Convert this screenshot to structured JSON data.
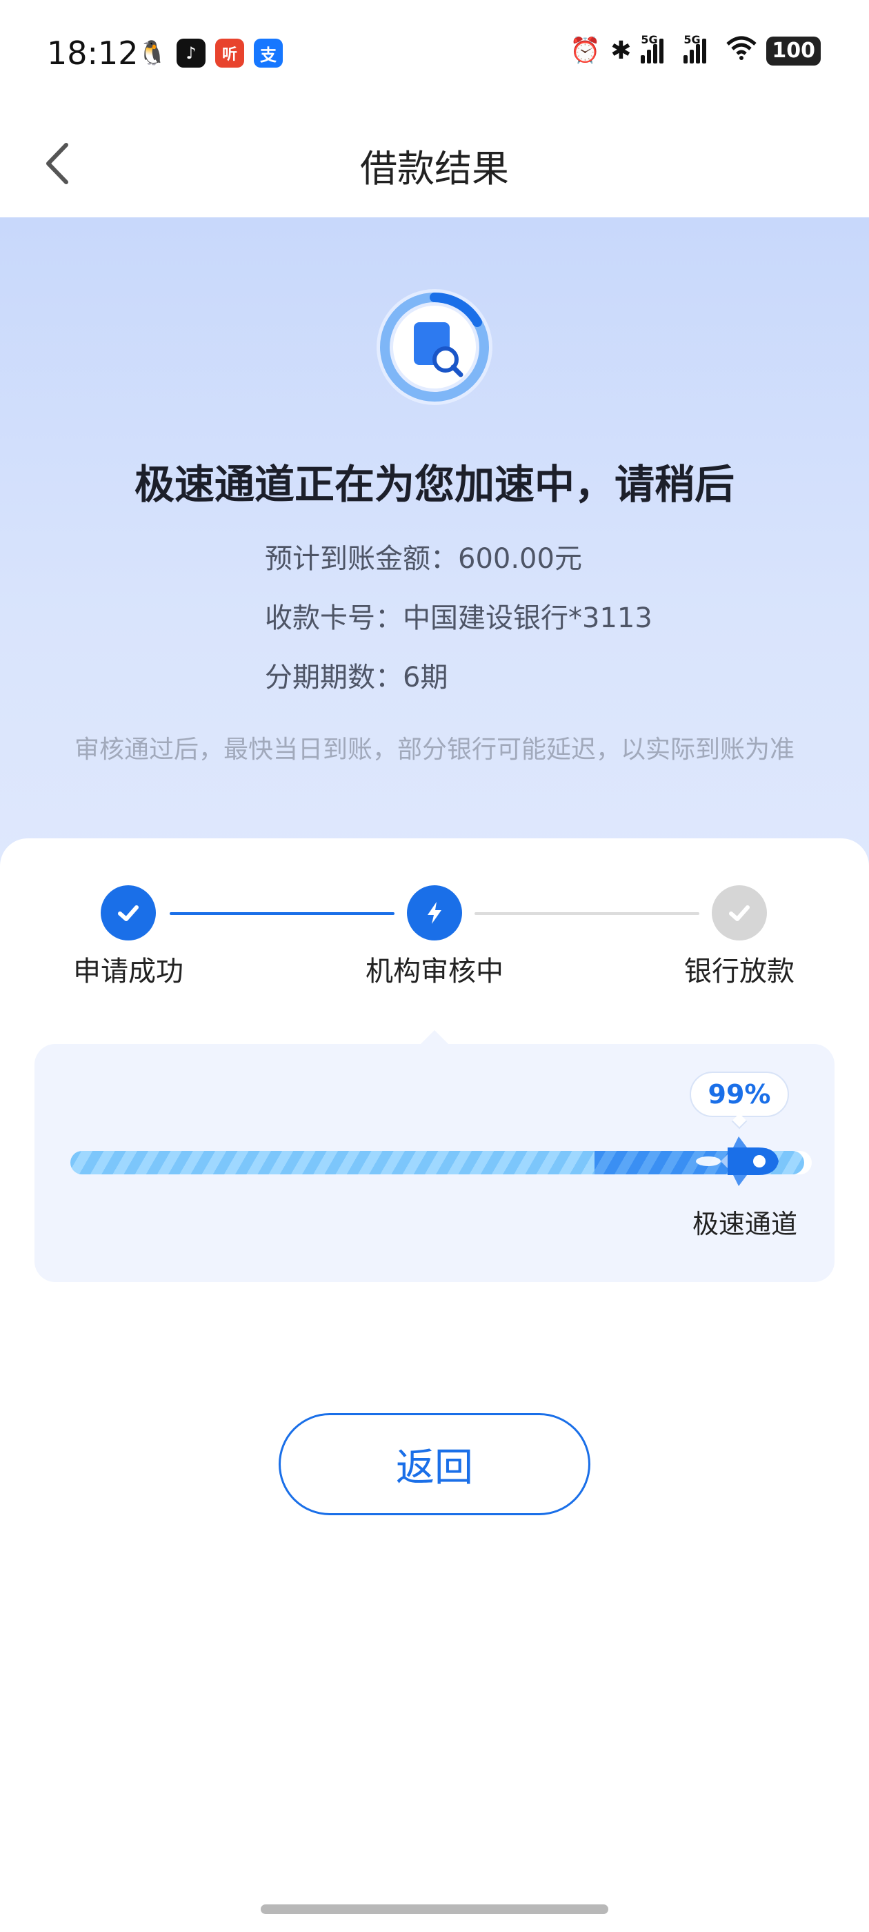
{
  "status_bar": {
    "time": "18:12",
    "app_icons": [
      "qq-icon",
      "tiktok-icon",
      "ting-icon",
      "alipay-icon"
    ],
    "ting_glyph": "听",
    "alipay_glyph": "支",
    "signal_1": "5G",
    "signal_2": "5G",
    "battery": "100"
  },
  "nav": {
    "title": "借款结果"
  },
  "hero": {
    "title": "极速通道正在为您加速中，请稍后",
    "expected_amount": "预计到账金额：600.00元",
    "card_number": "收款卡号：中国建设银行*3113",
    "installments": "分期期数：6期",
    "note": "审核通过后，最快当日到账，部分银行可能延迟，以实际到账为准"
  },
  "steps": [
    {
      "label": "申请成功",
      "state": "done"
    },
    {
      "label": "机构审核中",
      "state": "active"
    },
    {
      "label": "银行放款",
      "state": "pending"
    }
  ],
  "progress": {
    "percent_label": "99%",
    "percent_value": 0.99,
    "channel_label": "极速通道"
  },
  "actions": {
    "return_label": "返回"
  },
  "colors": {
    "accent": "#1a6fe8",
    "hero_bg": "#c8d8fb",
    "pending": "#d6d6d6"
  }
}
